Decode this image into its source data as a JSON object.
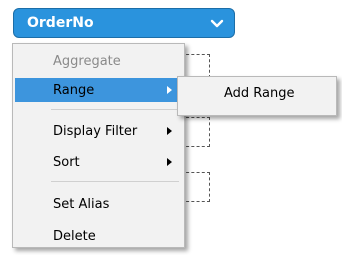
{
  "field": {
    "label": "OrderNo"
  },
  "menu": {
    "items": [
      {
        "label": "Aggregate"
      },
      {
        "label": "Range"
      },
      {
        "label": "Display Filter"
      },
      {
        "label": "Sort"
      },
      {
        "label": "Set Alias"
      },
      {
        "label": "Delete"
      }
    ]
  },
  "submenu": {
    "items": [
      {
        "label": "Add Range"
      }
    ]
  },
  "colors": {
    "accent": "#2a93dd",
    "highlight": "#3d95dd",
    "menu_bg": "#f2f2f2"
  }
}
